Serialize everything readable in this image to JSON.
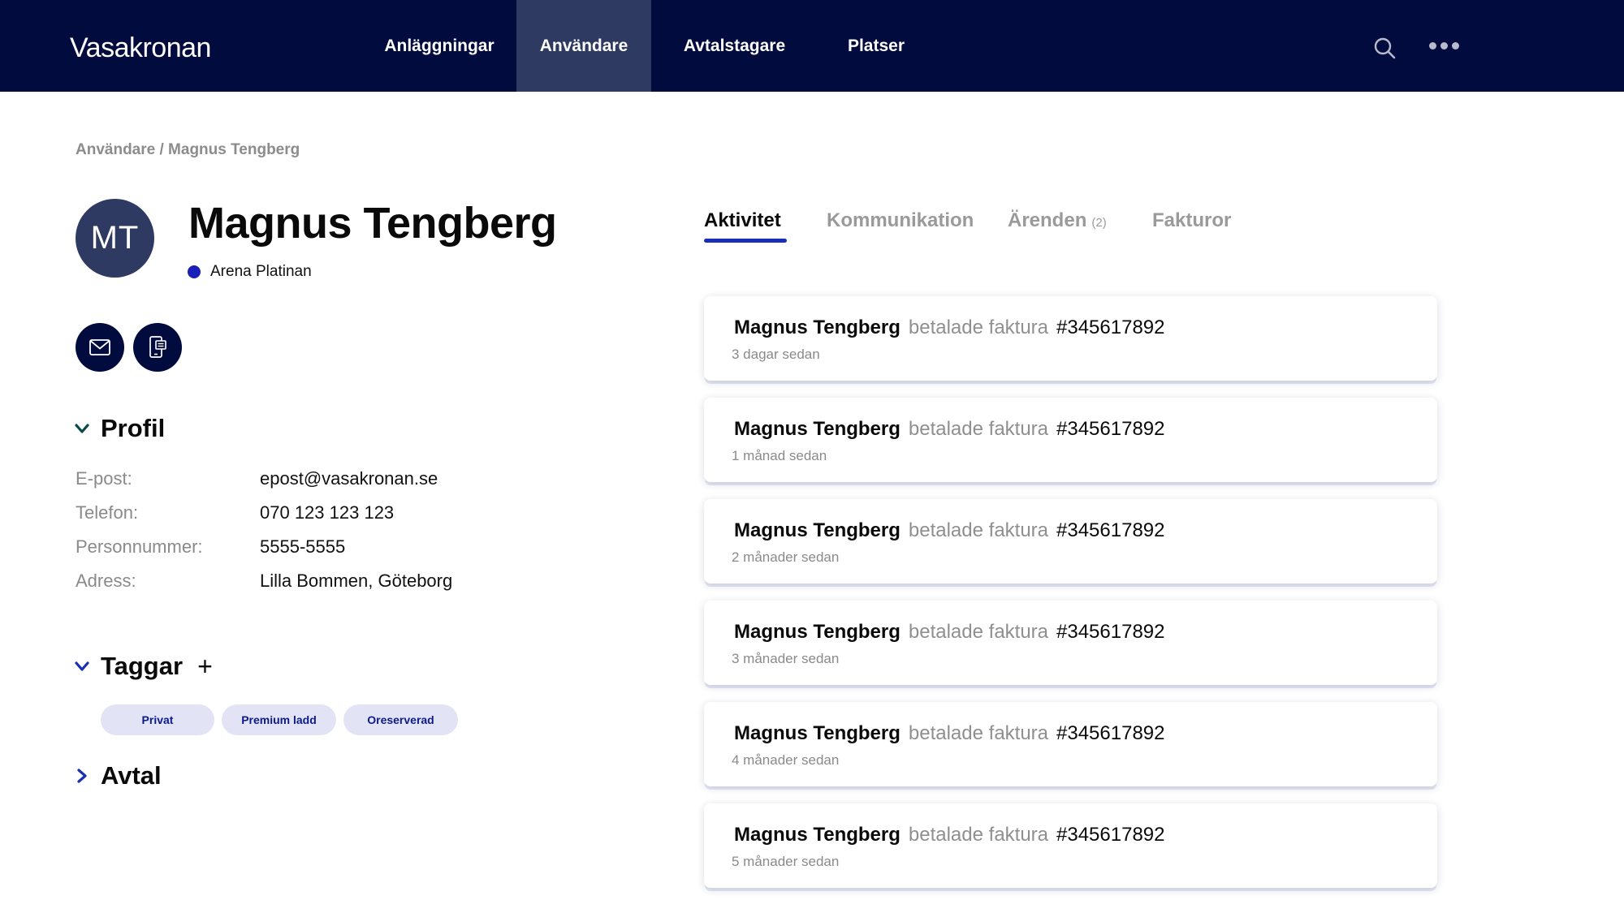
{
  "app": {
    "brand": "Vasakronan"
  },
  "nav": {
    "items": [
      "Anläggningar",
      "Användare",
      "Avtalstagare",
      "Platser"
    ],
    "active": "Användare"
  },
  "breadcrumb": {
    "parent": "Användare",
    "separator": "/",
    "current": "Magnus Tengberg"
  },
  "user": {
    "initials": "MT",
    "name": "Magnus Tengberg",
    "location": "Arena Platinan",
    "location_color": "#1a1fb8"
  },
  "actions": {
    "mail_icon": "mail-icon",
    "phone_icon": "phone-icon"
  },
  "profile": {
    "title": "Profil",
    "fields": [
      {
        "label": "E-post:",
        "value": "epost@vasakronan.se"
      },
      {
        "label": "Telefon:",
        "value": "070 123 123 123"
      },
      {
        "label": "Personnummer:",
        "value": "5555-5555"
      },
      {
        "label": "Adress:",
        "value": "Lilla Bommen, Göteborg"
      }
    ]
  },
  "tags": {
    "title": "Taggar",
    "add_label": "+",
    "items": [
      "Privat",
      "Premium ladd",
      "Oreserverad"
    ]
  },
  "contract": {
    "title": "Avtal"
  },
  "tabs": {
    "items": [
      {
        "label": "Aktivitet",
        "count": ""
      },
      {
        "label": "Kommunikation",
        "count": ""
      },
      {
        "label": "Ärenden",
        "count": "(2)"
      },
      {
        "label": "Fakturor",
        "count": ""
      }
    ],
    "active": "Aktivitet"
  },
  "activity": [
    {
      "actor": "Magnus Tengberg",
      "verb": "betalade faktura",
      "ref": "#345617892",
      "time": "3 dagar sedan"
    },
    {
      "actor": "Magnus Tengberg",
      "verb": "betalade faktura",
      "ref": "#345617892",
      "time": "1 månad sedan"
    },
    {
      "actor": "Magnus Tengberg",
      "verb": "betalade faktura",
      "ref": "#345617892",
      "time": "2 månader sedan"
    },
    {
      "actor": "Magnus Tengberg",
      "verb": "betalade faktura",
      "ref": "#345617892",
      "time": "3 månader sedan"
    },
    {
      "actor": "Magnus Tengberg",
      "verb": "betalade faktura",
      "ref": "#345617892",
      "time": "4 månader sedan"
    },
    {
      "actor": "Magnus Tengberg",
      "verb": "betalade faktura",
      "ref": "#345617892",
      "time": "5 månader sedan"
    }
  ],
  "colors": {
    "header": "#010b3d",
    "active_nav": "#2f3a62",
    "accent": "#1a2fb5",
    "tag_bg": "#e2e4f6"
  }
}
